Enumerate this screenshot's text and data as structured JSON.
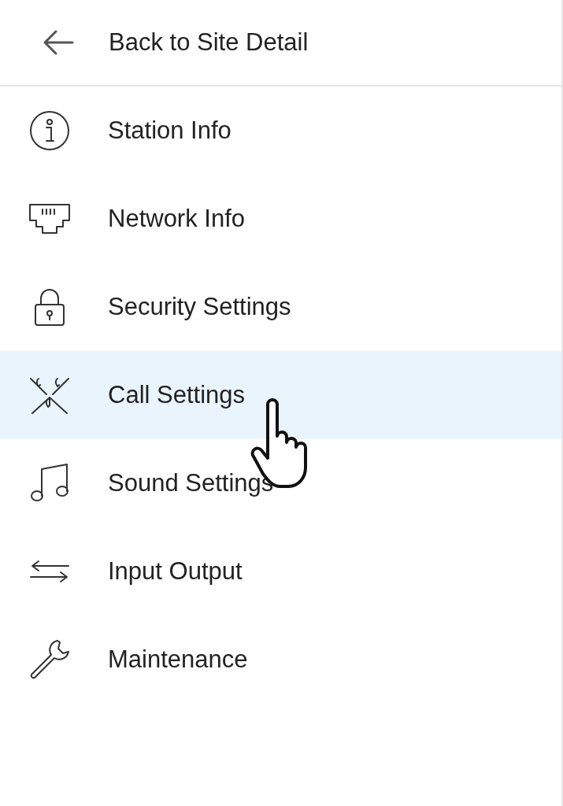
{
  "back": {
    "label": "Back to Site Detail"
  },
  "menu": [
    {
      "label": "Station Info",
      "selected": false
    },
    {
      "label": "Network Info",
      "selected": false
    },
    {
      "label": "Security Settings",
      "selected": false
    },
    {
      "label": "Call Settings",
      "selected": true
    },
    {
      "label": "Sound Settings",
      "selected": false
    },
    {
      "label": "Input Output",
      "selected": false
    },
    {
      "label": "Maintenance",
      "selected": false
    }
  ]
}
